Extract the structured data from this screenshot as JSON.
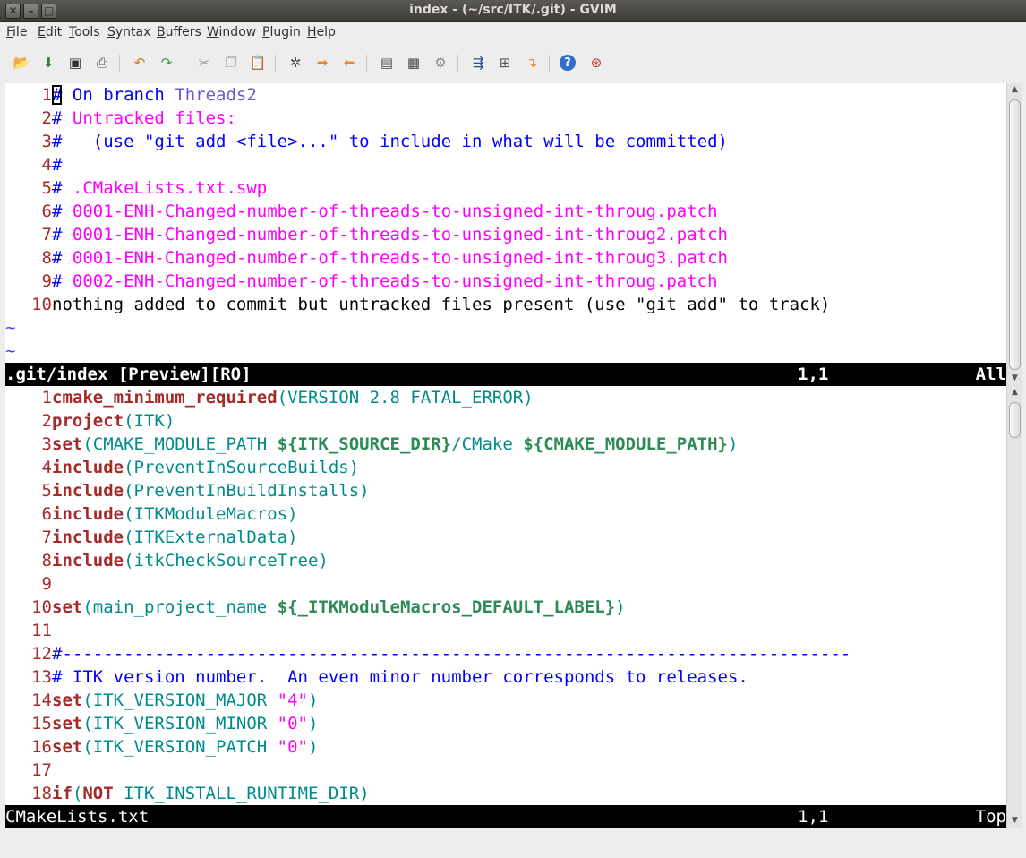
{
  "window": {
    "title": "index - (~/src/ITK/.git) - GVIM",
    "buttons": {
      "close": "✕",
      "minimize": "–",
      "maximize": "□"
    }
  },
  "menubar": [
    {
      "first": "F",
      "rest": "ile"
    },
    {
      "first": "E",
      "rest": "dit"
    },
    {
      "first": "T",
      "rest": "ools"
    },
    {
      "first": "S",
      "rest": "yntax"
    },
    {
      "first": "B",
      "rest": "uffers"
    },
    {
      "first": "W",
      "rest": "indow"
    },
    {
      "first": "P",
      "rest": "lugin"
    },
    {
      "first": "H",
      "rest": "elp"
    }
  ],
  "toolbar": {
    "icons": [
      "open-icon",
      "save-icon",
      "save-all-icon",
      "print-icon",
      "undo-icon",
      "redo-icon",
      "cut-icon",
      "copy-icon",
      "paste-icon",
      "find-replace-icon",
      "find-next-icon",
      "find-prev-icon",
      "load-session-icon",
      "save-session-icon",
      "run-script-icon",
      "make-icon",
      "shell-icon",
      "tags-icon",
      "help-icon",
      "find-help-icon"
    ]
  },
  "preview_pane": {
    "lines": [
      {
        "n": "1",
        "parts": [
          [
            "#",
            "c-comment cursor"
          ],
          [
            " On branch ",
            "c-comment"
          ],
          [
            "Threads2",
            "c-branch"
          ]
        ]
      },
      {
        "n": "2",
        "parts": [
          [
            "# ",
            "c-comment"
          ],
          [
            "Untracked files:",
            "c-untracked"
          ]
        ]
      },
      {
        "n": "3",
        "parts": [
          [
            "#   (use \"git add <file>...\" to include in what will be committed)",
            "c-comment"
          ]
        ]
      },
      {
        "n": "4",
        "parts": [
          [
            "#",
            "c-comment"
          ]
        ]
      },
      {
        "n": "5",
        "parts": [
          [
            "# ",
            "c-comment"
          ],
          [
            ".CMakeLists.txt.swp",
            "c-untracked"
          ]
        ]
      },
      {
        "n": "6",
        "parts": [
          [
            "# ",
            "c-comment"
          ],
          [
            "0001-ENH-Changed-number-of-threads-to-unsigned-int-throug.patch",
            "c-untracked"
          ]
        ]
      },
      {
        "n": "7",
        "parts": [
          [
            "# ",
            "c-comment"
          ],
          [
            "0001-ENH-Changed-number-of-threads-to-unsigned-int-throug2.patch",
            "c-untracked"
          ]
        ]
      },
      {
        "n": "8",
        "parts": [
          [
            "# ",
            "c-comment"
          ],
          [
            "0001-ENH-Changed-number-of-threads-to-unsigned-int-throug3.patch",
            "c-untracked"
          ]
        ]
      },
      {
        "n": "9",
        "parts": [
          [
            "# ",
            "c-comment"
          ],
          [
            "0002-ENH-Changed-number-of-threads-to-unsigned-int-throug.patch",
            "c-untracked"
          ]
        ]
      },
      {
        "n": "10",
        "parts": [
          [
            "nothing added to commit but untracked files present (use \"git add\" to track)",
            "c-normal"
          ]
        ]
      }
    ],
    "tildes": [
      "~",
      "~"
    ],
    "status": {
      "name": ".git/index [Preview][RO]",
      "position": "1,1",
      "scroll": "All"
    }
  },
  "main_pane": {
    "lines": [
      {
        "n": "1",
        "parts": [
          [
            "cmake_minimum_required",
            "c-kw"
          ],
          [
            "(VERSION 2.8 FATAL_ERROR)",
            "c-arg"
          ]
        ]
      },
      {
        "n": "2",
        "parts": [
          [
            "project",
            "c-kw"
          ],
          [
            "(ITK)",
            "c-arg"
          ]
        ]
      },
      {
        "n": "3",
        "parts": [
          [
            "set",
            "c-kw"
          ],
          [
            "(CMAKE_MODULE_PATH ",
            "c-arg"
          ],
          [
            "${ITK_SOURCE_DIR}",
            "c-var"
          ],
          [
            "/CMake ",
            "c-arg"
          ],
          [
            "${CMAKE_MODULE_PATH}",
            "c-var"
          ],
          [
            ")",
            "c-arg"
          ]
        ]
      },
      {
        "n": "4",
        "parts": [
          [
            "include",
            "c-kw"
          ],
          [
            "(PreventInSourceBuilds)",
            "c-arg"
          ]
        ]
      },
      {
        "n": "5",
        "parts": [
          [
            "include",
            "c-kw"
          ],
          [
            "(PreventInBuildInstalls)",
            "c-arg"
          ]
        ]
      },
      {
        "n": "6",
        "parts": [
          [
            "include",
            "c-kw"
          ],
          [
            "(ITKModuleMacros)",
            "c-arg"
          ]
        ]
      },
      {
        "n": "7",
        "parts": [
          [
            "include",
            "c-kw"
          ],
          [
            "(ITKExternalData)",
            "c-arg"
          ]
        ]
      },
      {
        "n": "8",
        "parts": [
          [
            "include",
            "c-kw"
          ],
          [
            "(itkCheckSourceTree)",
            "c-arg"
          ]
        ]
      },
      {
        "n": "9",
        "parts": []
      },
      {
        "n": "10",
        "parts": [
          [
            "set",
            "c-kw"
          ],
          [
            "(main_project_name ",
            "c-arg"
          ],
          [
            "${_ITKModuleMacros_DEFAULT_LABEL}",
            "c-var"
          ],
          [
            ")",
            "c-arg"
          ]
        ]
      },
      {
        "n": "11",
        "parts": []
      },
      {
        "n": "12",
        "parts": [
          [
            "#-----------------------------------------------------------------------------",
            "c-sep"
          ]
        ]
      },
      {
        "n": "13",
        "parts": [
          [
            "# ITK version number.  An even minor number corresponds to releases.",
            "c-comment"
          ]
        ]
      },
      {
        "n": "14",
        "parts": [
          [
            "set",
            "c-kw"
          ],
          [
            "(ITK_VERSION_MAJOR ",
            "c-arg"
          ],
          [
            "\"4\"",
            "c-str"
          ],
          [
            ")",
            "c-arg"
          ]
        ]
      },
      {
        "n": "15",
        "parts": [
          [
            "set",
            "c-kw"
          ],
          [
            "(ITK_VERSION_MINOR ",
            "c-arg"
          ],
          [
            "\"0\"",
            "c-str"
          ],
          [
            ")",
            "c-arg"
          ]
        ]
      },
      {
        "n": "16",
        "parts": [
          [
            "set",
            "c-kw"
          ],
          [
            "(ITK_VERSION_PATCH ",
            "c-arg"
          ],
          [
            "\"0\"",
            "c-str"
          ],
          [
            ")",
            "c-arg"
          ]
        ]
      },
      {
        "n": "17",
        "parts": []
      },
      {
        "n": "18",
        "parts": [
          [
            "if",
            "c-kw"
          ],
          [
            "(",
            "c-arg"
          ],
          [
            "NOT",
            "c-kw"
          ],
          [
            " ITK_INSTALL_RUNTIME_DIR)",
            "c-arg"
          ]
        ]
      }
    ],
    "status": {
      "name": "CMakeLists.txt",
      "position": "1,1",
      "scroll": "Top"
    }
  }
}
